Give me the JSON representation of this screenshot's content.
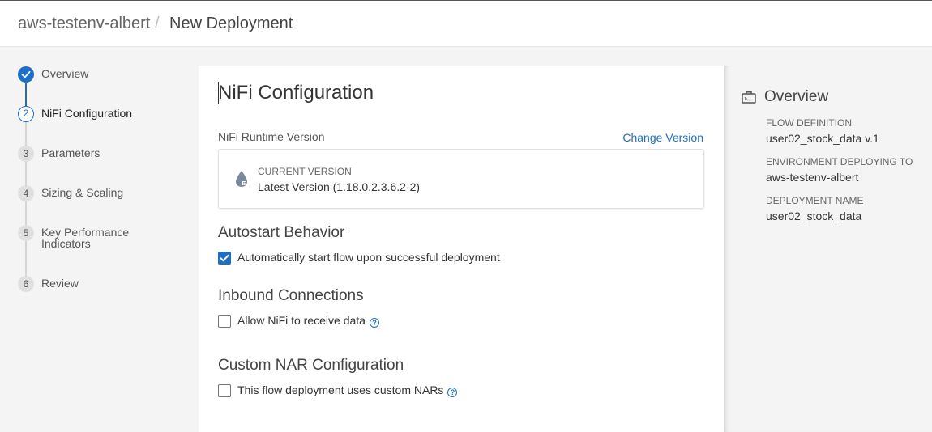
{
  "breadcrumb": {
    "environment": "aws-testenv-albert",
    "separator": "/",
    "page": "New Deployment"
  },
  "stepper": {
    "steps": [
      {
        "number": "",
        "label": "Overview",
        "state": "done"
      },
      {
        "number": "2",
        "label": "NiFi Configuration",
        "state": "active"
      },
      {
        "number": "3",
        "label": "Parameters",
        "state": "pending"
      },
      {
        "number": "4",
        "label": "Sizing & Scaling",
        "state": "pending"
      },
      {
        "number": "5",
        "label": "Key Performance Indicators",
        "state": "pending"
      },
      {
        "number": "6",
        "label": "Review",
        "state": "pending"
      }
    ]
  },
  "main": {
    "title": "NiFi Configuration",
    "runtime": {
      "label": "NiFi Runtime Version",
      "change_link": "Change Version",
      "current_caption": "CURRENT VERSION",
      "current_value": "Latest Version (1.18.0.2.3.6.2-2)"
    },
    "autostart": {
      "title": "Autostart Behavior",
      "checkbox_label": "Automatically start flow upon successful deployment",
      "checked": true
    },
    "inbound": {
      "title": "Inbound Connections",
      "checkbox_label": "Allow NiFi to receive data",
      "checked": false,
      "help_icon": "?"
    },
    "custom_nar": {
      "title": "Custom NAR Configuration",
      "checkbox_label": "This flow deployment uses custom NARs",
      "checked": false,
      "help_icon": "?"
    }
  },
  "overview_panel": {
    "title": "Overview",
    "fields": [
      {
        "label": "FLOW DEFINITION",
        "value": "user02_stock_data v.1"
      },
      {
        "label": "ENVIRONMENT DEPLOYING TO",
        "value": "aws-testenv-albert"
      },
      {
        "label": "DEPLOYMENT NAME",
        "value": "user02_stock_data"
      }
    ]
  },
  "colors": {
    "accent": "#1d6ec7",
    "background": "#f4f4f4",
    "card": "#ffffff"
  }
}
